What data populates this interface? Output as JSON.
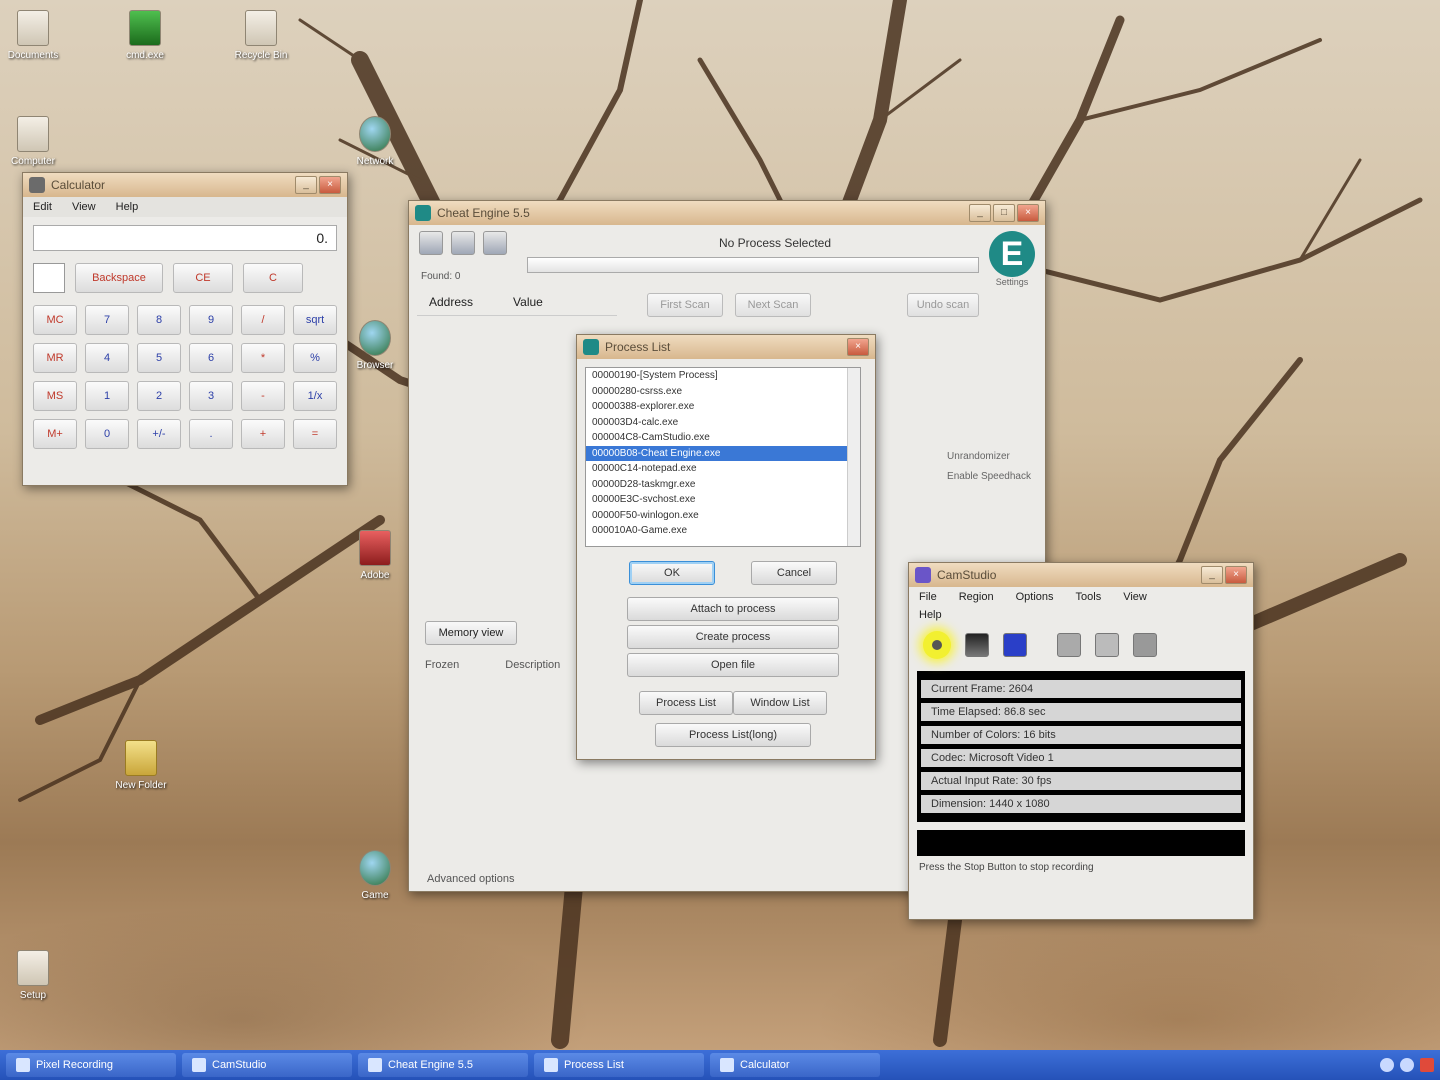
{
  "desktop": {
    "icons": [
      {
        "label": "Documents",
        "type": "doc"
      },
      {
        "label": "cmd.exe",
        "type": "green"
      },
      {
        "label": "Recycle Bin",
        "type": "doc"
      },
      {
        "label": "Computer",
        "type": "doc"
      },
      {
        "label": "Network",
        "type": "globe"
      },
      {
        "label": "Browser",
        "type": "globe"
      },
      {
        "label": "Adobe",
        "type": "red"
      },
      {
        "label": "New Folder",
        "type": "folder"
      },
      {
        "label": "Setup",
        "type": "doc"
      },
      {
        "label": "Game",
        "type": "globe"
      }
    ]
  },
  "calculator": {
    "title": "Calculator",
    "menu": [
      "Edit",
      "View",
      "Help"
    ],
    "display": "0.",
    "top_buttons": [
      "Backspace",
      "CE",
      "C"
    ],
    "keys": [
      "MC",
      "7",
      "8",
      "9",
      "/",
      "sqrt",
      "MR",
      "4",
      "5",
      "6",
      "*",
      "%",
      "MS",
      "1",
      "2",
      "3",
      "-",
      "1/x",
      "M+",
      "0",
      "+/-",
      ".",
      "+",
      "="
    ]
  },
  "cheat_engine": {
    "title": "Cheat Engine 5.5",
    "process_label": "No Process Selected",
    "found_label": "Found: 0",
    "logo_letter": "E",
    "logo_caption": "Settings",
    "col_address": "Address",
    "col_value": "Value",
    "first_scan": "First Scan",
    "next_scan": "Next Scan",
    "undo_scan": "Undo scan",
    "checks": [
      "Unrandomizer",
      "Enable Speedhack"
    ],
    "memory_view": "Memory view",
    "list_headers": [
      "Frozen",
      "Description"
    ],
    "advanced": "Advanced options"
  },
  "process_list": {
    "title": "Process List",
    "rows": [
      "00000190-[System Process]",
      "00000280-csrss.exe",
      "00000388-explorer.exe",
      "000003D4-calc.exe",
      "000004C8-CamStudio.exe",
      "00000B08-Cheat Engine.exe",
      "00000C14-notepad.exe",
      "00000D28-taskmgr.exe",
      "00000E3C-svchost.exe",
      "00000F50-winlogon.exe",
      "000010A0-Game.exe"
    ],
    "selected_index": 5,
    "ok": "OK",
    "cancel": "Cancel",
    "attach": "Attach to process",
    "create": "Create process",
    "open_file": "Open file",
    "process_list_btn": "Process List",
    "window_list_btn": "Window List",
    "process_list_long": "Process List(long)"
  },
  "camstudio": {
    "title": "CamStudio",
    "menu": [
      "File",
      "Region",
      "Options",
      "Tools",
      "View",
      "Help"
    ],
    "stats": [
      "Current Frame: 2604",
      "Time Elapsed: 86.8 sec",
      "Number of Colors: 16 bits",
      "Codec: Microsoft Video 1",
      "Actual Input Rate: 30 fps",
      "Dimension: 1440 x 1080"
    ],
    "status": "Press the Stop Button to stop recording"
  },
  "taskbar": {
    "buttons": [
      "Pixel Recording",
      "CamStudio",
      "Cheat Engine 5.5",
      "Process List",
      "Calculator"
    ]
  },
  "colors": {
    "title_bar": "#d8b78e",
    "taskbar": "#2552b8",
    "selection": "#3a78d6",
    "ce_logo": "#1f8a86"
  }
}
